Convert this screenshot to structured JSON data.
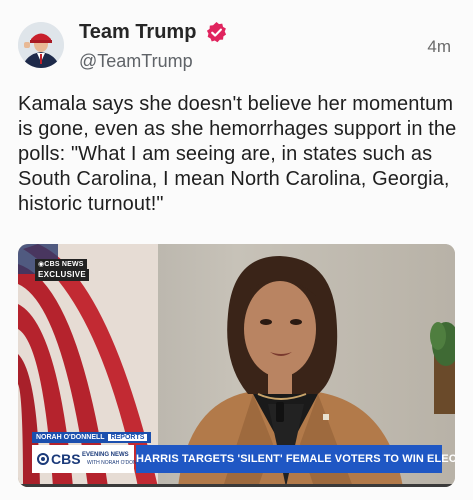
{
  "post": {
    "author": {
      "display_name": "Team Trump",
      "handle": "@TeamTrump",
      "verified_icon": "verified-badge-icon",
      "verified_color": "#e0245e"
    },
    "timestamp": "4m",
    "text": "Kamala says she doesn't believe her momentum is gone, even as she hemorrhages support in the polls: \"What I am seeing are, in states such as South Carolina, I mean North Carolina, Georgia, historic turnout!\"",
    "media": {
      "network_bug": "◉CBS NEWS",
      "exclusive": "EXCLUSIVE",
      "lower_third": {
        "tag": "NORAH O'DONNELL",
        "tag_reports": "REPORTS",
        "logo_cbs": "CBS",
        "logo_evening": "EVENING NEWS",
        "logo_anchor": "WITH NORAH O'DONNELL",
        "headline": "HARRIS TARGETS 'SILENT' FEMALE VOTERS TO WIN ELECTION",
        "bar_color": "#1f57c4"
      }
    }
  }
}
